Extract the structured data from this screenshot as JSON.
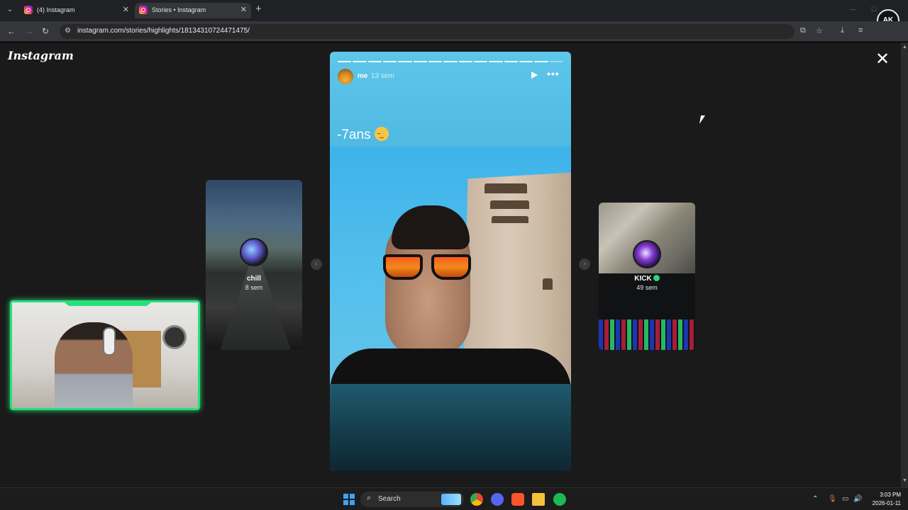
{
  "browser": {
    "tabs": [
      {
        "title": "(4) Instagram",
        "active": false
      },
      {
        "title": "Stories • Instagram",
        "active": true
      }
    ],
    "url": "instagram.com/stories/highlights/18134310724471475/",
    "profile_badge": "AK"
  },
  "page": {
    "logo": "Instagram",
    "prev_story": {
      "name": "chill",
      "age": "8 sem"
    },
    "next_story": {
      "name": "KICK",
      "age": "49 sem",
      "verified": true
    },
    "current_story": {
      "user": "me",
      "time": "13 sem",
      "caption": "-7ans",
      "progress_segments": 15,
      "progress_completed": 14
    }
  },
  "taskbar": {
    "search_label": "Search",
    "time": "3:03 PM",
    "date": "2026-01-11"
  },
  "colors": {
    "webcam_frame": "#27e07a",
    "verified": "#35d17b"
  }
}
